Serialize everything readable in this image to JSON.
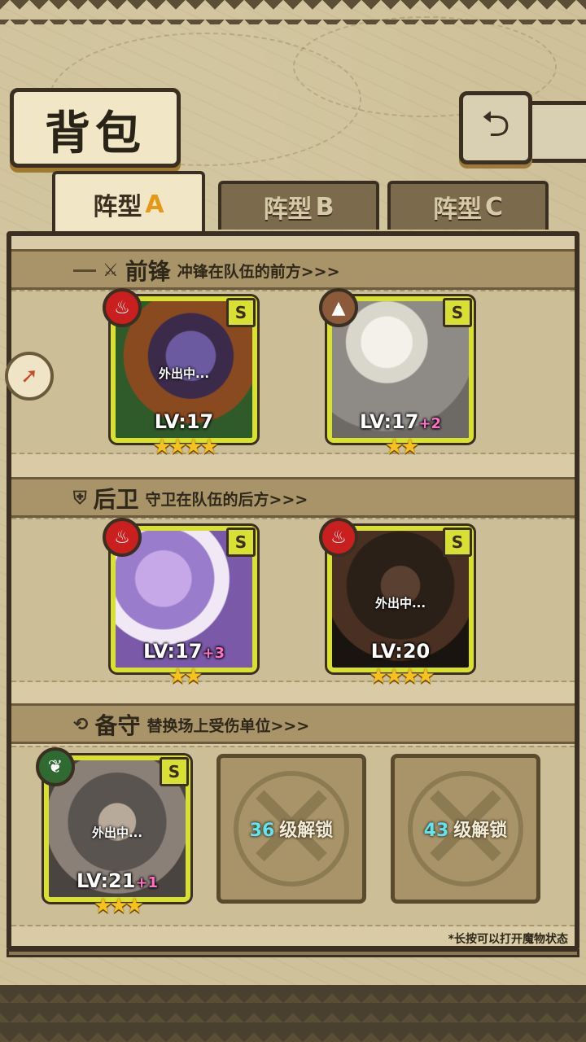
{
  "header": {
    "title": "背包",
    "back_icon": "back-arrow-icon"
  },
  "tabs": [
    {
      "label": "阵型",
      "suffix": "A",
      "active": true
    },
    {
      "label": "阵型",
      "suffix": "B",
      "active": false
    },
    {
      "label": "阵型",
      "suffix": "C",
      "active": false
    }
  ],
  "sections": {
    "front": {
      "name": "前锋",
      "desc": "冲锋在队伍的前方>>>",
      "icon": "sword-icon"
    },
    "back": {
      "name": "后卫",
      "desc": "守卫在队伍的后方>>>",
      "icon": "shield-icon"
    },
    "reserve": {
      "name": "备守",
      "desc": "替换场上受伤单位>>>",
      "icon": "swap-icon"
    }
  },
  "cards": [
    {
      "rank": "S",
      "element": "fire",
      "status": "外出中...",
      "level": "LV:17",
      "bonus": "",
      "stars": "★★★★"
    },
    {
      "rank": "S",
      "element": "earth",
      "status": "",
      "level": "LV:17",
      "bonus": "+2",
      "stars": "★★"
    },
    {
      "rank": "S",
      "element": "fire",
      "status": "",
      "level": "LV:17",
      "bonus": "+3",
      "stars": "★★"
    },
    {
      "rank": "S",
      "element": "fire",
      "status": "外出中...",
      "level": "LV:20",
      "bonus": "",
      "stars": "★★★★"
    },
    {
      "rank": "S",
      "element": "wood",
      "status": "外出中...",
      "level": "LV:21",
      "bonus": "+1",
      "stars": "★★★"
    }
  ],
  "locked_slots": [
    {
      "level": "36",
      "text": "级解锁"
    },
    {
      "level": "43",
      "text": "级解锁"
    }
  ],
  "footnote": "*长按可以打开魔物状态",
  "colors": {
    "rank_frame": "#d8e032",
    "fire": "#c91f1f",
    "earth": "#8a5a3a",
    "wood": "#2f6a32",
    "star": "#f6c21c",
    "bonus": "#ff6fc6",
    "unlock_level": "#5fe4f0"
  }
}
